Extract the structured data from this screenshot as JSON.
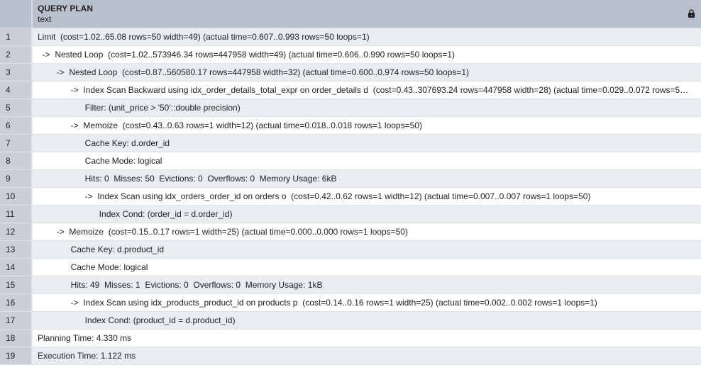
{
  "header": {
    "title": "QUERY PLAN",
    "type": "text",
    "lock_icon": "lock-icon"
  },
  "rows": [
    {
      "n": "1",
      "text": "Limit  (cost=1.02..65.08 rows=50 width=49) (actual time=0.607..0.993 rows=50 loops=1)"
    },
    {
      "n": "2",
      "text": "  ->  Nested Loop  (cost=1.02..573946.34 rows=447958 width=49) (actual time=0.606..0.990 rows=50 loops=1)"
    },
    {
      "n": "3",
      "text": "        ->  Nested Loop  (cost=0.87..560580.17 rows=447958 width=32) (actual time=0.600..0.974 rows=50 loops=1)"
    },
    {
      "n": "4",
      "text": "              ->  Index Scan Backward using idx_order_details_total_expr on order_details d  (cost=0.43..307693.24 rows=447958 width=28) (actual time=0.029..0.072 rows=5…"
    },
    {
      "n": "5",
      "text": "                    Filter: (unit_price > '50'::double precision)"
    },
    {
      "n": "6",
      "text": "              ->  Memoize  (cost=0.43..0.63 rows=1 width=12) (actual time=0.018..0.018 rows=1 loops=50)"
    },
    {
      "n": "7",
      "text": "                    Cache Key: d.order_id"
    },
    {
      "n": "8",
      "text": "                    Cache Mode: logical"
    },
    {
      "n": "9",
      "text": "                    Hits: 0  Misses: 50  Evictions: 0  Overflows: 0  Memory Usage: 6kB"
    },
    {
      "n": "10",
      "text": "                    ->  Index Scan using idx_orders_order_id on orders o  (cost=0.42..0.62 rows=1 width=12) (actual time=0.007..0.007 rows=1 loops=50)"
    },
    {
      "n": "11",
      "text": "                          Index Cond: (order_id = d.order_id)"
    },
    {
      "n": "12",
      "text": "        ->  Memoize  (cost=0.15..0.17 rows=1 width=25) (actual time=0.000..0.000 rows=1 loops=50)"
    },
    {
      "n": "13",
      "text": "              Cache Key: d.product_id"
    },
    {
      "n": "14",
      "text": "              Cache Mode: logical"
    },
    {
      "n": "15",
      "text": "              Hits: 49  Misses: 1  Evictions: 0  Overflows: 0  Memory Usage: 1kB"
    },
    {
      "n": "16",
      "text": "              ->  Index Scan using idx_products_product_id on products p  (cost=0.14..0.16 rows=1 width=25) (actual time=0.002..0.002 rows=1 loops=1)"
    },
    {
      "n": "17",
      "text": "                    Index Cond: (product_id = d.product_id)"
    },
    {
      "n": "18",
      "text": "Planning Time: 4.330 ms"
    },
    {
      "n": "19",
      "text": "Execution Time: 1.122 ms"
    }
  ]
}
